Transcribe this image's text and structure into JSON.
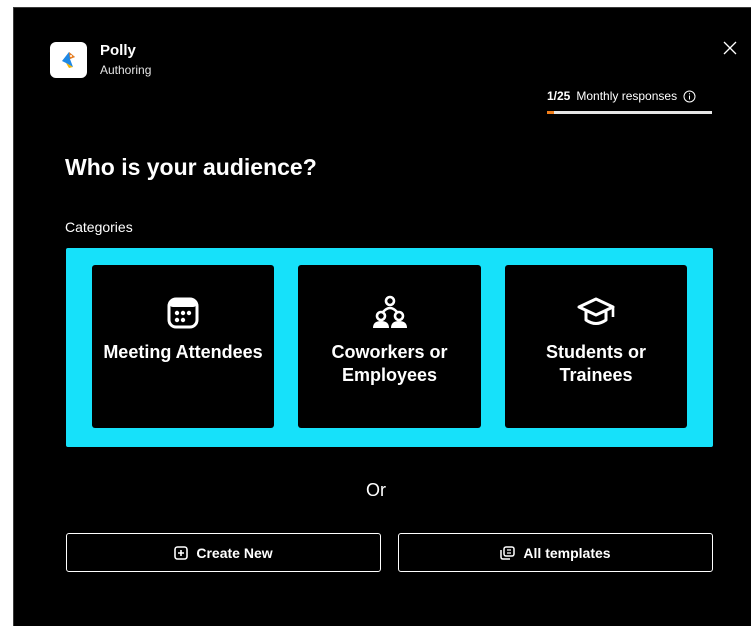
{
  "app": {
    "name": "Polly",
    "subtitle": "Authoring",
    "logo_icon": "polly-parrot-logo"
  },
  "usage": {
    "count": "1/25",
    "label": "Monthly responses",
    "info_icon": "info-icon",
    "progress_fraction": 0.04,
    "progress_color": "#f07e1b"
  },
  "main": {
    "heading": "Who is your audience?",
    "categories_label": "Categories",
    "categories": [
      {
        "label": "Meeting Attendees",
        "icon": "calendar-icon"
      },
      {
        "label": "Coworkers or Employees",
        "icon": "people-group-icon"
      },
      {
        "label": "Students or Trainees",
        "icon": "graduation-cap-icon"
      }
    ],
    "or_text": "Or",
    "actions": {
      "create_new": "Create New",
      "all_templates": "All templates"
    }
  },
  "colors": {
    "background": "#000000",
    "accent_panel": "#16e1fa",
    "text": "#ffffff"
  }
}
